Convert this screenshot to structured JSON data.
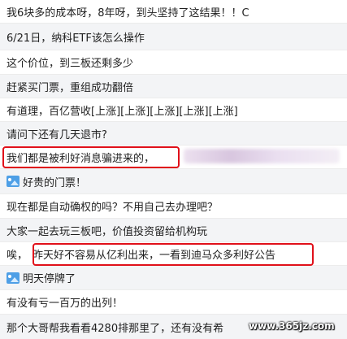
{
  "comments": [
    {
      "text": "我6块多的成本呀，8年呀，到头坚持了这结果！！C"
    },
    {
      "text": "6/21日，纳科ETF该怎么操作"
    },
    {
      "text": "这个价位，到三板还剩多少"
    },
    {
      "text": "赶紧买门票，重组成功翻倍"
    },
    {
      "text": "有道理，百亿营收[上涨][上涨][上涨][上涨][上涨]"
    },
    {
      "text": "请问下还有几天退市?"
    },
    {
      "text": "我们都是被利好消息骗进来的，",
      "highlighted": true,
      "redacted_after": true
    },
    {
      "text": "好贵的门票！",
      "icon": "image-emoji-icon"
    },
    {
      "text": "现在都是自动确权的吗？不用自己去办理吧？"
    },
    {
      "text": "大家一起去玩三板吧，价值投资留给机构玩"
    },
    {
      "text": "唉，",
      "text2": "昨天好不容易从亿利出来，一看到迪马众多利好公告",
      "highlighted": true
    },
    {
      "text": "明天停牌了",
      "icon": "image-emoji-icon"
    },
    {
      "text": "有没有亏一百万的出列！"
    },
    {
      "text": "那个大哥帮我看看4280排那里了，还有没有希"
    }
  ],
  "watermark": "www.365jz.com",
  "colors": {
    "highlight": "#e0101a",
    "row_alt": "#f3f4f6",
    "icon": "#4e9fe6"
  }
}
